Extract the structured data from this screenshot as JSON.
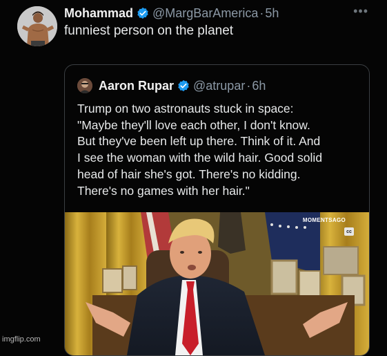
{
  "tweet": {
    "author_name": "Mohammad",
    "author_handle": "@MargBarAmerica",
    "separator": "·",
    "time": "5h",
    "more_label": "•••",
    "text": "funniest person on the planet"
  },
  "quote": {
    "author_name": "Aaron Rupar",
    "author_handle": "@atrupar",
    "separator": "·",
    "time": "6h",
    "lines": [
      "Trump on two astronauts stuck in space:",
      "\"Maybe they'll love each other, I don't know.",
      "But they've been left up there. Think of it. And",
      "I see the woman with the wild hair. Good solid",
      "head of hair she's got. There's no kidding.",
      "There's no games with her hair.\""
    ],
    "media": {
      "watermark": "MOMENTSAGO",
      "badge": "cc"
    }
  },
  "footer": {
    "site_watermark": "imgflip.com"
  },
  "colors": {
    "verified": "#1d9bf0",
    "text": "#e7e9ea",
    "muted": "#8b98a5",
    "border": "#3b3f43"
  }
}
